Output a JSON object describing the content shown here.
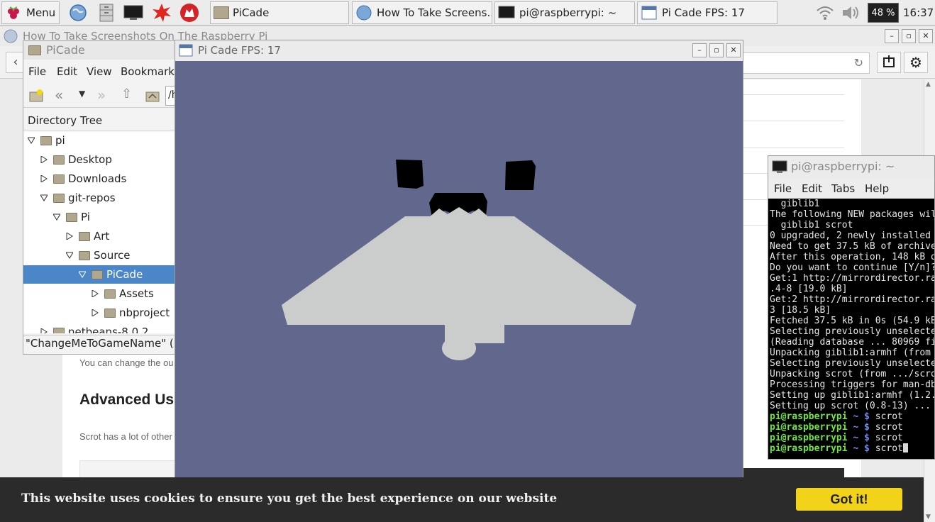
{
  "taskbar": {
    "menu_label": "Menu",
    "tasks": [
      {
        "label": "PiCade"
      },
      {
        "label": "How To Take Screens..."
      },
      {
        "label": "pi@raspberrypi: ~"
      },
      {
        "label": "Pi Cade  FPS: 17"
      }
    ],
    "battery": "48 %",
    "clock": "16:37"
  },
  "browser": {
    "title": "How To Take Screenshots On The Raspberry Pi",
    "article_line1": "You can change the ou",
    "article_heading": "Advanced Us",
    "article_line2": "Scrot has a lot of other"
  },
  "file_manager": {
    "title": "PiCade",
    "menu": [
      "File",
      "Edit",
      "View",
      "Bookmarks"
    ],
    "path_value": "/h",
    "dir_header": "Directory Tree",
    "tree": [
      {
        "label": "pi",
        "level": 0,
        "expanded": true
      },
      {
        "label": "Desktop",
        "level": 1,
        "expanded": false
      },
      {
        "label": "Downloads",
        "level": 1,
        "expanded": false
      },
      {
        "label": "git-repos",
        "level": 1,
        "expanded": true
      },
      {
        "label": "Pi",
        "level": 2,
        "expanded": true
      },
      {
        "label": "Art",
        "level": 3,
        "expanded": false
      },
      {
        "label": "Source",
        "level": 3,
        "expanded": true
      },
      {
        "label": "PiCade",
        "level": 4,
        "expanded": true,
        "selected": true
      },
      {
        "label": "Assets",
        "level": 5,
        "expanded": false
      },
      {
        "label": "nbproject",
        "level": 5,
        "expanded": false
      },
      {
        "label": "netbeans-8.0.2",
        "level": 1,
        "expanded": false
      }
    ],
    "status": "\"ChangeMeToGameName\" (19"
  },
  "picade": {
    "title": "Pi Cade  FPS: 17",
    "colors": {
      "background": "#62678d",
      "ship": "#cbcdcd",
      "eyes": "#000000"
    }
  },
  "terminal": {
    "title": "pi@raspberrypi: ~",
    "menu": [
      "File",
      "Edit",
      "Tabs",
      "Help"
    ],
    "output": [
      "  giblib1",
      "The following NEW packages wil",
      "  giblib1 scrot",
      "0 upgraded, 2 newly installed",
      "Need to get 37.5 kB of archive",
      "After this operation, 148 kB o",
      "Do you want to continue [Y/n]?",
      "Get:1 http://mirrordirector.ra",
      ".4-8 [19.0 kB]",
      "Get:2 http://mirrordirector.ra",
      "3 [18.5 kB]",
      "Fetched 37.5 kB in 0s (54.9 kB",
      "Selecting previously unselecte",
      "(Reading database ... 80969 fi",
      "Unpacking giblib1:armhf (from",
      "Selecting previously unselecte",
      "Unpacking scrot (from .../scro",
      "Processing triggers for man-db",
      "Setting up giblib1:armhf (1.2.",
      "Setting up scrot (0.8-13) ..."
    ],
    "prompt_user": "pi@raspberrypi",
    "prompt_path": "~ $",
    "commands": [
      "scrot",
      "scrot",
      "scrot",
      "scrot"
    ]
  },
  "cookie": {
    "text": "This website uses cookies to ensure you get the best experience on our website",
    "button": "Got it!"
  }
}
